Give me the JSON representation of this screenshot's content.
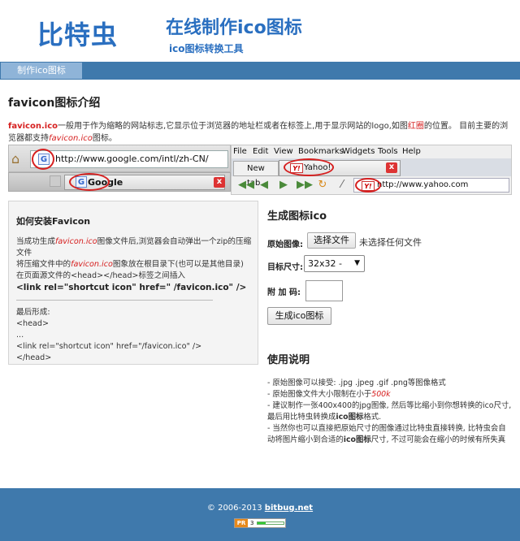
{
  "header": {
    "logo": "比特虫",
    "title": "在线制作ico图标",
    "subtitle": "ico图标转换工具"
  },
  "nav": {
    "tab": "制作ico图标"
  },
  "intro": {
    "title": "favicon图标介绍",
    "term": "favicon.ico",
    "text_a": "一般用于作为缩略的网站标志,它显示位于浏览器的地址栏或者在标签上,用于显示网站的logo,如图",
    "red_circle": "红圈",
    "text_b": "的位置。 目前主要的浏览器都支持",
    "term_italic": "favicon.ico",
    "text_c": "图标。"
  },
  "illustration": {
    "ie_url": "http://www.google.com/intl/zh-CN/",
    "ie_tab": "Google",
    "g_glyph": "G",
    "close_glyph": "x",
    "home_glyph": "⌂",
    "ff_menu": [
      "File",
      "Edit",
      "View",
      "Bookmarks",
      "Widgets",
      "Tools",
      "Help"
    ],
    "ff_tab1": "New tab",
    "ff_tab2": "Yahoo!",
    "ff_url": "http://www.yahoo.com",
    "y_glyph": "Y!",
    "nav_glyphs": [
      "◀◀",
      "◀",
      "▶",
      "▶▶",
      "↻",
      "⁄"
    ]
  },
  "install": {
    "title": "如何安装Favicon",
    "l1a": "当成功生成",
    "l1b": "favicon.ico",
    "l1c": "图像文件后,浏览器会自动弹出一个zip的压缩文件",
    "l2a": "将压缩文件中的",
    "l2b": "favicon.ico",
    "l2c": "图象放在根目录下(也可以是其他目录)",
    "l3": "在页面源文件的<head></head>标签之间插入",
    "code": "<link rel=\"shortcut icon\" href=\" /favicon.ico\" />",
    "final_lines": [
      "最后形成:",
      "<head>",
      "...",
      "<link rel=\"shortcut icon\" href=\"/favicon.ico\" />",
      "</head>"
    ]
  },
  "generate": {
    "title": "生成图标ico",
    "source_label": "原始图像:",
    "choose_file": "选择文件",
    "no_file": "未选择任何文件",
    "size_label": "目标尺寸:",
    "size_value": "32x32 -",
    "code_label": "附 加 码:",
    "submit": "生成ico图标"
  },
  "usage": {
    "title": "使用说明",
    "u1": "- 原始图像可以接受: .jpg .jpeg .gif .png等图像格式",
    "u2a": "- 原始图像文件大小限制在小于",
    "u2b": "500k",
    "u3a": "- 建议制作一张400x400的jpg图像, 然后等比缩小到你想转换的ico尺寸,最后用比特虫转换成",
    "u3b": "ico图标",
    "u3c": "格式.",
    "u4a": "- 当然你也可以直接把原始尺寸的图像通过比特虫直接转换, 比特虫会自动将图片缩小到合适的",
    "u4b": "ico图标",
    "u4c": "尺寸, 不过可能会在缩小的时候有所失真"
  },
  "footer": {
    "copyright": "© 2006-2013",
    "link": "bitbug.net",
    "pr_label": "PR",
    "pr_value": "3",
    "pr_fraction": 0.3
  }
}
